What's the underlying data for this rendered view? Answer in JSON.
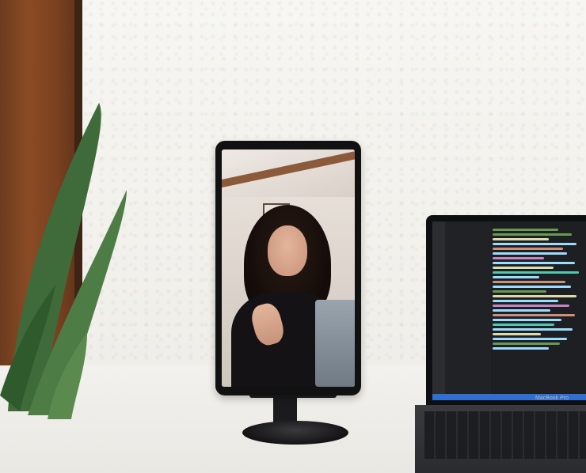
{
  "laptop": {
    "brand_label": "MacBook Pro"
  },
  "colors": {
    "wall": "#f4f3ef",
    "wood": "#7a4020",
    "plant": "#3f6b3a",
    "stand": "#1b1b1d",
    "editor_bg": "#1e1f23",
    "status_bar": "#2f6fd1"
  }
}
